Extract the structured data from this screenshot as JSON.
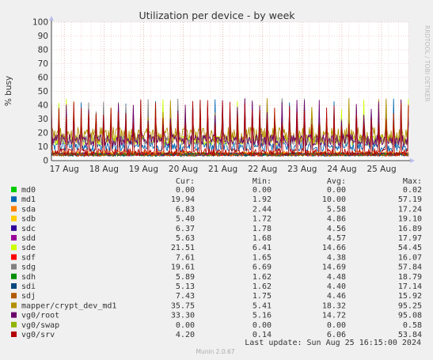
{
  "chart_data": {
    "type": "line",
    "title": "Utilization per device - by week",
    "ylabel": "% busy",
    "ylim": [
      0,
      100
    ],
    "yticks": [
      0,
      10,
      20,
      30,
      40,
      50,
      60,
      70,
      80,
      90,
      100
    ],
    "xticks": [
      "17 Aug",
      "18 Aug",
      "19 Aug",
      "20 Aug",
      "21 Aug",
      "22 Aug",
      "23 Aug",
      "24 Aug",
      "25 Aug"
    ],
    "xrange": [
      "16 Aug 16:15",
      "25 Aug 16:15"
    ],
    "grid": true,
    "legend_placement": "below",
    "watermark": "RRDTOOL / TOBI OETIKER",
    "columns": {
      "cur": "Cur:",
      "min": "Min:",
      "avg": "Avg:",
      "max": "Max:"
    },
    "series": [
      {
        "name": "md0",
        "color": "#00cc00",
        "cur": "0.00",
        "min": "0.00",
        "avg": "0.00",
        "max": "0.02"
      },
      {
        "name": "md1",
        "color": "#0066b3",
        "cur": "19.94",
        "min": "1.92",
        "avg": "10.00",
        "max": "57.19"
      },
      {
        "name": "sda",
        "color": "#ff8000",
        "cur": "6.83",
        "min": "2.44",
        "avg": "5.58",
        "max": "17.24"
      },
      {
        "name": "sdb",
        "color": "#ffcc00",
        "cur": "5.40",
        "min": "1.72",
        "avg": "4.86",
        "max": "19.10"
      },
      {
        "name": "sdc",
        "color": "#330099",
        "cur": "6.37",
        "min": "1.78",
        "avg": "4.56",
        "max": "16.89"
      },
      {
        "name": "sdd",
        "color": "#990099",
        "cur": "5.63",
        "min": "1.68",
        "avg": "4.57",
        "max": "17.97"
      },
      {
        "name": "sde",
        "color": "#ccff00",
        "cur": "21.51",
        "min": "6.41",
        "avg": "14.66",
        "max": "54.45"
      },
      {
        "name": "sdf",
        "color": "#ff0000",
        "cur": "7.61",
        "min": "1.65",
        "avg": "4.38",
        "max": "16.07"
      },
      {
        "name": "sdg",
        "color": "#808080",
        "cur": "19.61",
        "min": "6.69",
        "avg": "14.69",
        "max": "57.84"
      },
      {
        "name": "sdh",
        "color": "#008f00",
        "cur": "5.89",
        "min": "1.62",
        "avg": "4.48",
        "max": "18.79"
      },
      {
        "name": "sdi",
        "color": "#00487d",
        "cur": "5.13",
        "min": "1.62",
        "avg": "4.40",
        "max": "17.14"
      },
      {
        "name": "sdj",
        "color": "#b35a00",
        "cur": "7.43",
        "min": "1.75",
        "avg": "4.46",
        "max": "15.92"
      },
      {
        "name": "mapper/crypt_dev_md1",
        "color": "#b38f00",
        "cur": "35.75",
        "min": "5.41",
        "avg": "18.32",
        "max": "95.25"
      },
      {
        "name": "vg0/root",
        "color": "#6b006b",
        "cur": "33.30",
        "min": "5.16",
        "avg": "14.72",
        "max": "95.08"
      },
      {
        "name": "vg0/swap",
        "color": "#8fb300",
        "cur": "0.00",
        "min": "0.00",
        "avg": "0.00",
        "max": "0.58"
      },
      {
        "name": "vg0/srv",
        "color": "#b30000",
        "cur": "4.20",
        "min": "0.14",
        "avg": "6.06",
        "max": "53.84"
      }
    ]
  },
  "footer": {
    "last_update": "Last update: Sun Aug 25 16:15:00 2024",
    "munin_version": "Munin 2.0.67"
  }
}
